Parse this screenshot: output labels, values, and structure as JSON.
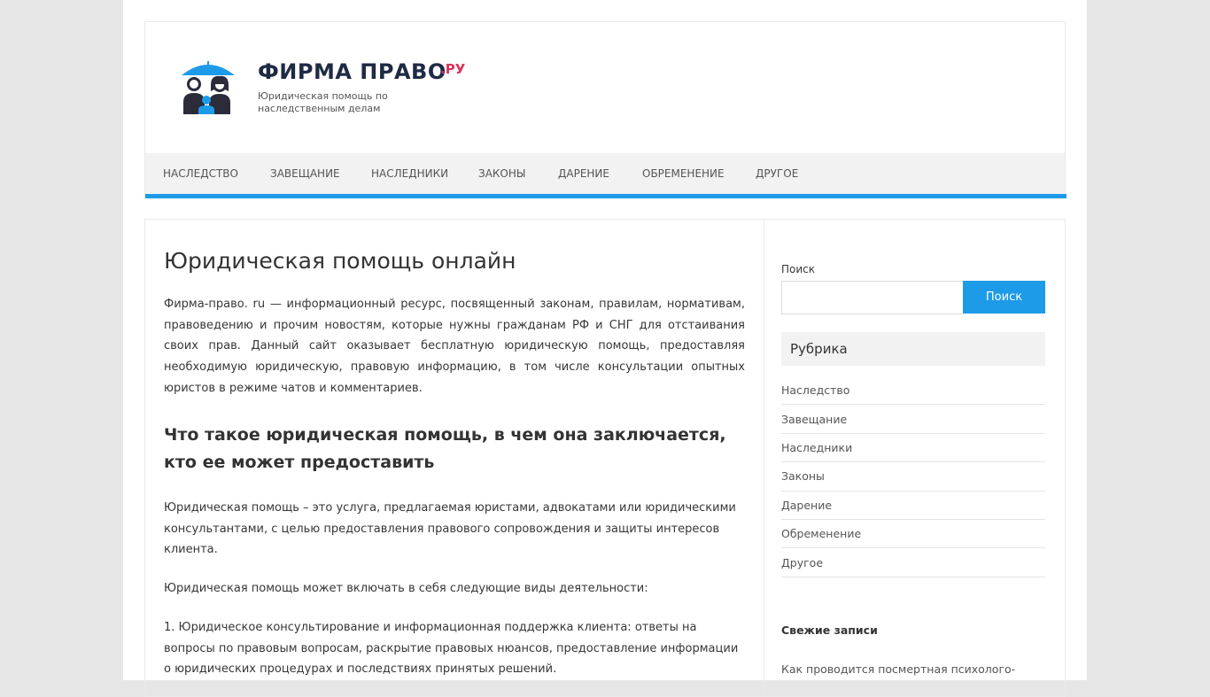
{
  "logo": {
    "title": "ФИРМА ПРАВО",
    "suffix": ".РУ",
    "subtitle": "Юридическая помощь по наследственным делам"
  },
  "nav": {
    "items": [
      {
        "label": "НАСЛЕДСТВО"
      },
      {
        "label": "ЗАВЕЩАНИЕ"
      },
      {
        "label": "НАСЛЕДНИКИ"
      },
      {
        "label": "ЗАКОНЫ"
      },
      {
        "label": "ДАРЕНИЕ"
      },
      {
        "label": "ОБРЕМЕНЕНИЕ"
      },
      {
        "label": "ДРУГОЕ"
      }
    ]
  },
  "main": {
    "title": "Юридическая помощь онлайн",
    "intro": "Фирма-право. ru — информационный ресурс, посвященный законам, правилам, нормативам, правоведению и прочим новостям, которые нужны гражданам РФ и СНГ для отстаивания своих прав. Данный сайт оказывает бесплатную юридическую помощь, предоставляя необходимую юридическую, правовую информацию, в том числе консультации опытных юристов в режиме чатов и комментариев.",
    "section_title": "Что такое юридическая помощь, в чем она заключается, кто ее может предоставить",
    "paragraphs": [
      "Юридическая помощь – это услуга, предлагаемая юристами, адвокатами или юридическими консультантами, с целью предоставления правового сопровождения и защиты интересов клиента.",
      "Юридическая помощь может включать в себя следующие виды деятельности:",
      "1. Юридическое консультирование и информационная поддержка клиента: ответы на вопросы по правовым вопросам, раскрытие правовых нюансов, предоставление информации о юридических процедурах и последствиях принятых решений."
    ]
  },
  "sidebar": {
    "search_label": "Поиск",
    "search_value": "",
    "search_button": "Поиск",
    "categories_title": "Рубрика",
    "categories": [
      {
        "label": "Наследство"
      },
      {
        "label": "Завещание"
      },
      {
        "label": "Наследники"
      },
      {
        "label": "Законы"
      },
      {
        "label": "Дарение"
      },
      {
        "label": "Обременение"
      },
      {
        "label": "Другое"
      }
    ],
    "recent_title": "Свежие записи",
    "recent_first": "Как проводится посмертная психолого-"
  },
  "colors": {
    "accent": "#1e9be8",
    "logo_suffix": "#d9345a",
    "logo_title": "#1f2a44",
    "background": "#e6e6e6"
  }
}
